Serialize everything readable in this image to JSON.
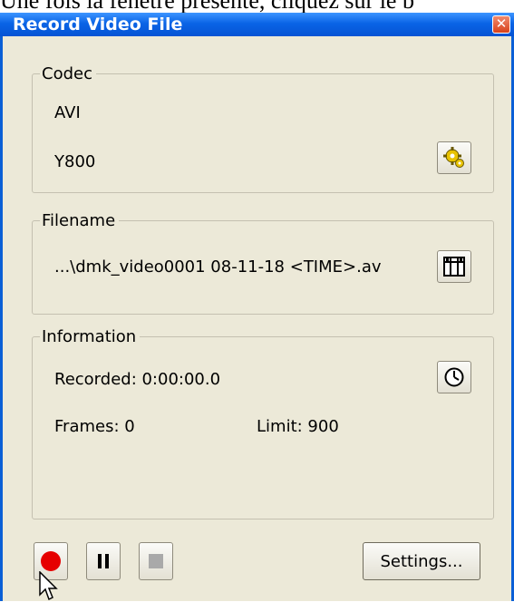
{
  "caption": "Une fois la fenêtre présente, cliquez sur le b",
  "window": {
    "title": "Record Video File",
    "close_glyph": "✕"
  },
  "codec": {
    "legend": "Codec",
    "container": "AVI",
    "format": "Y800",
    "properties_icon": "gear-icon"
  },
  "filename": {
    "legend": "Filename",
    "path": "...\\dmk_video0001 08-11-18 <TIME>.av",
    "browse_icon": "film-frames-icon"
  },
  "information": {
    "legend": "Information",
    "recorded": "Recorded: 0:00:00.0",
    "frames": "Frames: 0",
    "limit": "Limit: 900",
    "timer_icon": "clock-icon"
  },
  "controls": {
    "record_icon": "record-icon",
    "pause_icon": "pause-icon",
    "stop_icon": "stop-icon",
    "settings_label": "Settings..."
  },
  "colors": {
    "titlebar": "#0a64e6",
    "record": "#e60000",
    "window_bg": "#ece9d8"
  }
}
